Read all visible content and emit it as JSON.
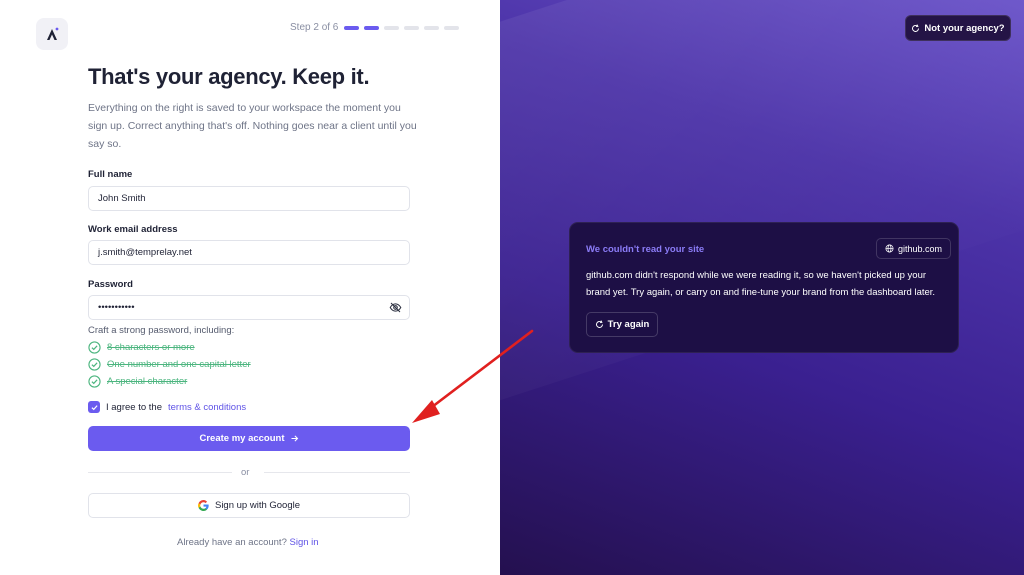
{
  "colors": {
    "accent": "#6b5bef",
    "success": "#4cb57f",
    "panel": "#1d0f45",
    "arrow": "#e0201f"
  },
  "header": {
    "step": "Step 2 of 6",
    "total_steps": 6,
    "current_step": 2
  },
  "intro": {
    "title": "That's your agency. Keep it.",
    "subtitle": "Everything on the right is saved to your workspace the moment you sign up. Correct anything that's off. Nothing goes near a client until you say so."
  },
  "form": {
    "full_name_label": "Full name",
    "full_name_value": "John Smith",
    "email_label": "Work email address",
    "email_value": "j.smith@temprelay.net",
    "password_label": "Password",
    "password_value": "•••••••••••",
    "requirements_title": "Craft a strong password, including:",
    "requirements": [
      "8 characters or more",
      "One number and one capital letter",
      "A special character"
    ],
    "agree_prefix": "I agree to the",
    "agree_link": "terms & conditions",
    "create_button": "Create my account",
    "or": "or",
    "google_button": "Sign up with Google",
    "signin_prompt": "Already have an account?",
    "signin_link": "Sign in"
  },
  "right": {
    "not_agency_button": "Not your agency?",
    "card_title": "We couldn't read your site",
    "source": "github.com",
    "card_body": "github.com didn't respond while we were reading it, so we haven't picked up your brand yet. Try again, or carry on and fine-tune your brand from the dashboard later.",
    "try_again": "Try again"
  },
  "icons": [
    "logo-icon",
    "eye-off-icon",
    "check-circle-icon",
    "checkbox-check-icon",
    "arrow-right-icon",
    "google-icon",
    "refresh-icon",
    "globe-icon"
  ]
}
